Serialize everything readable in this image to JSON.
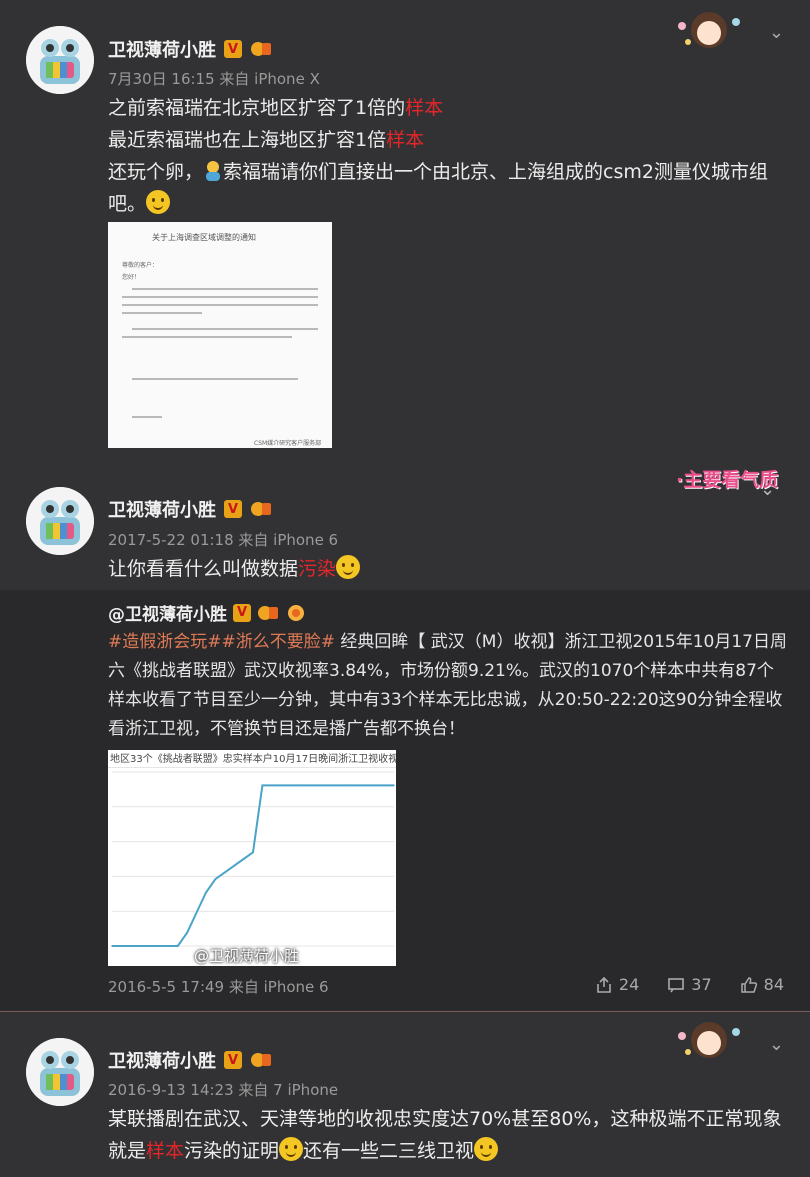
{
  "posts": [
    {
      "author": "卫视薄荷小胜",
      "meta": "7月30日 16:15 来自 iPhone X",
      "line1_a": "之前索福瑞在北京地区扩容了1倍的",
      "line1_b": "样本",
      "line2_a": "最近索福瑞也在上海地区扩容1倍",
      "line2_b": "样本",
      "line3": "还玩个卵，",
      "line3_b": "索福瑞请你们直接出一个由北京、上海组成的csm2测量仪城市组",
      "line4": "吧。",
      "doc_title": "关于上海调查区域调整的通知",
      "doc_greeting": "尊敬的客户：",
      "doc_hello": "您好！",
      "doc_sign": "CSM媒介研究客户服务部"
    },
    {
      "author": "卫视薄荷小胜",
      "meta": "2017-5-22 01:18 来自 iPhone 6",
      "text_a": "让你看看什么叫做数据",
      "text_b": "污染",
      "repost": {
        "author": "@卫视薄荷小胜",
        "tags": "#造假浙会玩##浙么不要脸#",
        "body": " 经典回眸【 武汉（M）收视】浙江卫视2015年10月17日周六《挑战者联盟》武汉收视率3.84%，市场份额9.21%。武汉的1070个样本中共有87个样本收看了节目至少一分钟，其中有33个样本无比忠诚，从20:50-22:20这90分钟全程收看浙江卫视，不管换节目还是播广告都不换台！",
        "chart_title": "地区33个《挑战者联盟》忠实样本户10月17日晚间浙江卫视收视",
        "watermark": "@卫视薄荷小胜",
        "meta": "2016-5-5 17:49 来自 iPhone 6",
        "share_count": "24",
        "comment_count": "37",
        "like_count": "84"
      },
      "sticker_text": "·主要看气质"
    },
    {
      "author": "卫视薄荷小胜",
      "meta": "2016-9-13 14:23 来自 7 iPhone",
      "line1": "某联播剧在武汉、天津等地的收视忠实度达70%甚至80%，这种极端不正常现象",
      "line2_a": "就是",
      "line2_b": "样本",
      "line2_c": "污染的证明",
      "line2_d": "还有一些二三线卫视"
    }
  ],
  "icons": {
    "verified": "V",
    "chevron": "chevron-down-icon",
    "share": "share-icon",
    "comment": "comment-icon",
    "like": "like-icon"
  },
  "colors": {
    "background": "#323234",
    "highlight": "#e3262a",
    "tag": "#e07a55"
  },
  "chart_data": {
    "type": "line",
    "title": "地区33个《挑战者联盟》忠实样本户10月17日晚间浙江卫视收视",
    "x": [
      0,
      1,
      2,
      3,
      4,
      5,
      6,
      7,
      8,
      9,
      10,
      11,
      12,
      13,
      14,
      15,
      16,
      17,
      18,
      19,
      20,
      21,
      22,
      23,
      24,
      25,
      26,
      27,
      28,
      29,
      30
    ],
    "series": [
      {
        "values": [
          0,
          0,
          0,
          0,
          0,
          0,
          0,
          0,
          2,
          5,
          8,
          10,
          11,
          12,
          13,
          14,
          24,
          24,
          24,
          24,
          24,
          24,
          24,
          24,
          24,
          24,
          24,
          24,
          24,
          24,
          24
        ]
      }
    ],
    "ylim": [
      0,
      26
    ],
    "grid": true
  }
}
